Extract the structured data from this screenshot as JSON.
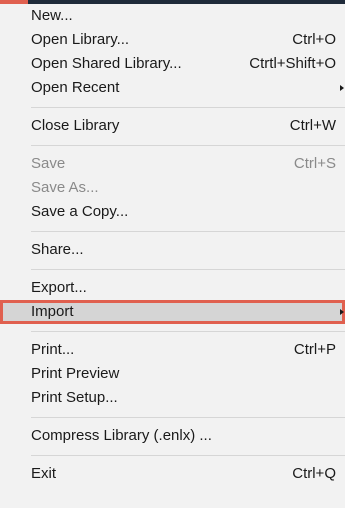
{
  "colors": {
    "menu_bg": "#f2f2f2",
    "highlight_bg": "#d5d5d5",
    "highlight_border": "#e0604f",
    "disabled_text": "#8a8a8a",
    "top_bar": "#1f2b3a"
  },
  "menu": {
    "group1": [
      {
        "label": "New...",
        "shortcut": ""
      },
      {
        "label": "Open Library...",
        "shortcut": "Ctrl+O"
      },
      {
        "label": "Open Shared Library...",
        "shortcut": "Ctrtl+Shift+O"
      },
      {
        "label": "Open Recent",
        "shortcut": ""
      }
    ],
    "group2": [
      {
        "label": "Close Library",
        "shortcut": "Ctrl+W"
      }
    ],
    "group3": [
      {
        "label": "Save",
        "shortcut": "Ctrl+S"
      },
      {
        "label": "Save As...",
        "shortcut": ""
      },
      {
        "label": "Save a Copy...",
        "shortcut": ""
      }
    ],
    "group4": [
      {
        "label": "Share...",
        "shortcut": ""
      }
    ],
    "group5": [
      {
        "label": "Export...",
        "shortcut": ""
      },
      {
        "label": "Import",
        "shortcut": ""
      }
    ],
    "group6": [
      {
        "label": "Print...",
        "shortcut": "Ctrl+P"
      },
      {
        "label": "Print Preview",
        "shortcut": ""
      },
      {
        "label": "Print Setup...",
        "shortcut": ""
      }
    ],
    "group7": [
      {
        "label": "Compress Library (.enlx) ...",
        "shortcut": ""
      }
    ],
    "group8": [
      {
        "label": "Exit",
        "shortcut": "Ctrl+Q"
      }
    ]
  }
}
